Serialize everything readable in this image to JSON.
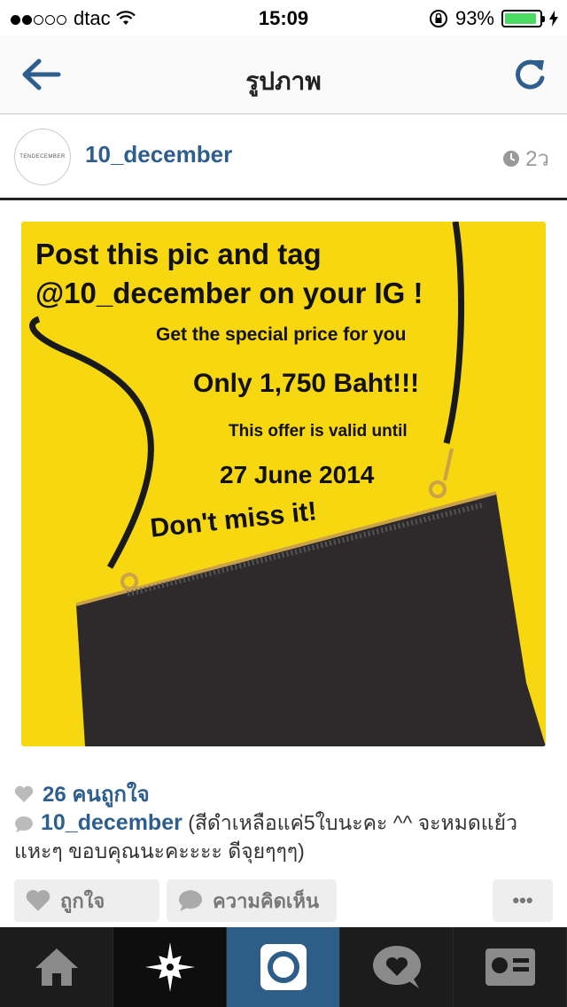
{
  "status_bar": {
    "carrier": "dtac",
    "time": "15:09",
    "battery": "93%",
    "battery_level": 0.93,
    "signal_bars": 2
  },
  "nav": {
    "title": "รูปภาพ",
    "back_icon": "back-arrow-icon",
    "refresh_icon": "refresh-icon"
  },
  "post": {
    "avatar_text": "TENDECEMBER",
    "username": "10_december",
    "time_ago": "2ว",
    "image_text": {
      "line1": "Post this pic and tag",
      "line2": "@10_december on your IG !",
      "line3": "Get the special price for you",
      "line4": "Only 1,750 Baht!!!",
      "line5": "This offer is valid until",
      "line6": "27 June 2014",
      "line7": "Don't miss it!"
    },
    "likes": "26 คนถูกใจ",
    "comment_user": "10_december",
    "comment_text": "(สีดำเหลือแค่5ใบนะคะ ^^ จะหมดแย้วแหะๆ ขอบคุณนะคะะะะ ดีจุยๆๆๆ)"
  },
  "actions": {
    "like_label": "ถูกใจ",
    "comment_label": "ความคิดเห็น",
    "more_label": "•••"
  },
  "tabs": [
    {
      "name": "home",
      "icon": "home-icon"
    },
    {
      "name": "explore",
      "icon": "explore-star-icon"
    },
    {
      "name": "camera",
      "icon": "camera-icon"
    },
    {
      "name": "activity",
      "icon": "heart-bubble-icon"
    },
    {
      "name": "profile",
      "icon": "profile-card-icon"
    }
  ],
  "colors": {
    "link_blue": "#2d5e8e",
    "photo_yellow": "#f7d70f",
    "camera_tab": "#2f5d8a",
    "battery_green": "#4cd964"
  }
}
